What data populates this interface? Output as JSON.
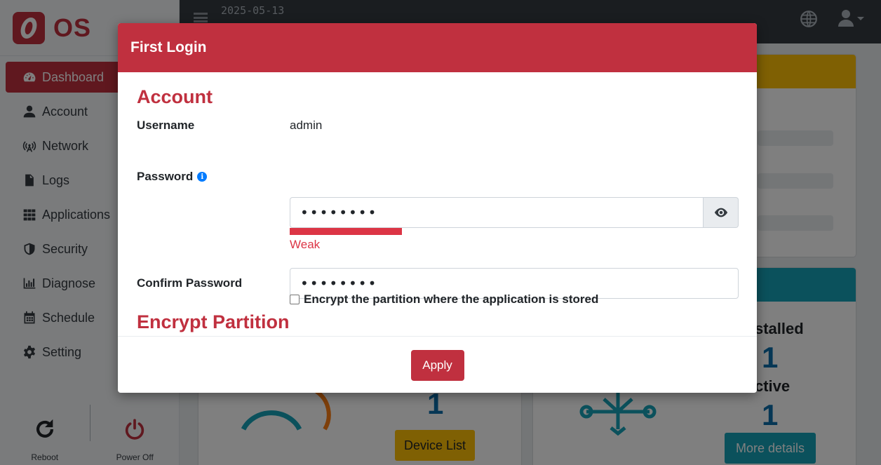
{
  "brand": {
    "name": "OS",
    "color": "#c0303f"
  },
  "sidebar": {
    "items": [
      {
        "label": "Dashboard",
        "icon": "dashboard-gauge-icon",
        "active": true
      },
      {
        "label": "Account",
        "icon": "user-icon"
      },
      {
        "label": "Network",
        "icon": "broadcast-tower-icon"
      },
      {
        "label": "Logs",
        "icon": "file-icon"
      },
      {
        "label": "Applications",
        "icon": "grid-icon"
      },
      {
        "label": "Security",
        "icon": "shield-icon"
      },
      {
        "label": "Diagnose",
        "icon": "bar-chart-icon"
      },
      {
        "label": "Schedule",
        "icon": "calendar-icon"
      },
      {
        "label": "Setting",
        "icon": "gear-icon"
      }
    ],
    "footer": {
      "reboot_label": "Reboot",
      "poweroff_label": "Power Off"
    }
  },
  "topbar": {
    "date": "2025-05-13"
  },
  "dashboard": {
    "installed_label": "stalled",
    "installed_value": "1",
    "active_label": "ctive",
    "active_value": "1",
    "device_count": "1",
    "device_list_button": "Device List",
    "more_details_button": "More details"
  },
  "modal": {
    "title": "First Login",
    "account_section": "Account",
    "username_label": "Username",
    "username_value": "admin",
    "password_label": "Password",
    "password_value": "••••••••",
    "password_strength": "Weak",
    "password_strength_fraction": 0.25,
    "confirm_label": "Confirm Password",
    "confirm_value": "••••••••",
    "encrypt_section": "Encrypt Partition",
    "encrypt_checkbox_label": "Encrypt the partition where the application is stored",
    "encrypt_checked": false,
    "apply_button": "Apply"
  },
  "colors": {
    "accent": "#c0303f",
    "warning": "#ffc107",
    "info": "#17a2b8",
    "danger": "#dc3545"
  }
}
